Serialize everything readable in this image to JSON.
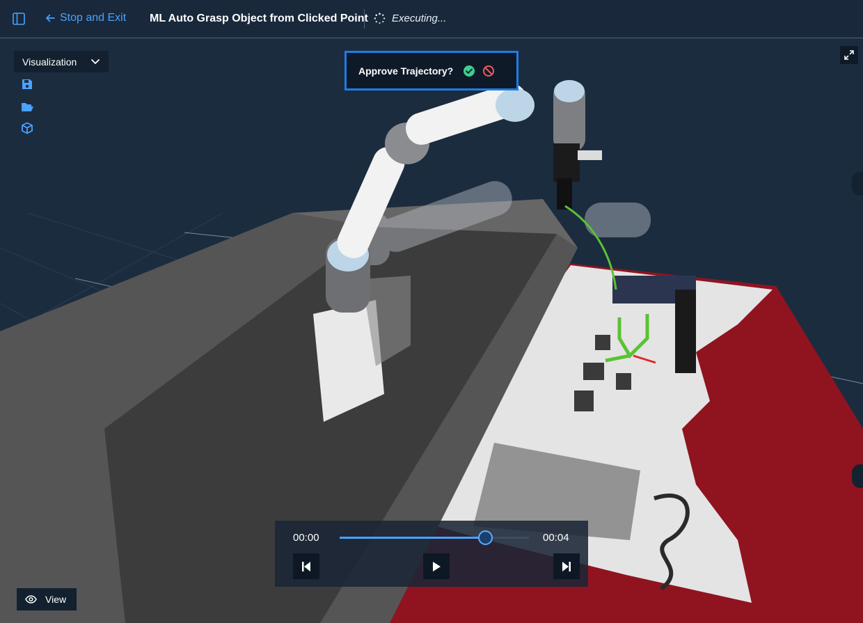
{
  "header": {
    "back_label": "Stop and Exit",
    "title": "ML Auto Grasp Object from Clicked Point",
    "status": "Executing..."
  },
  "toolbar": {
    "dropdown_label": "Visualization",
    "icons": [
      "sidebar-toggle-icon",
      "save-icon",
      "folder-open-icon",
      "cube-icon",
      "expand-icon"
    ]
  },
  "approval": {
    "prompt": "Approve Trajectory?",
    "approve_icon": "check-circle-icon",
    "reject_icon": "ban-icon"
  },
  "player": {
    "time_start": "00:00",
    "time_end": "00:04",
    "progress": 0.77
  },
  "view_button": {
    "label": "View"
  },
  "colors": {
    "accent": "#4aa3ff",
    "approve": "#3ecf8e",
    "reject": "#ef5b5b",
    "background": "#1c2c3f",
    "trajectory": "#5bc236",
    "pointcloud_red": "#8f1420"
  }
}
